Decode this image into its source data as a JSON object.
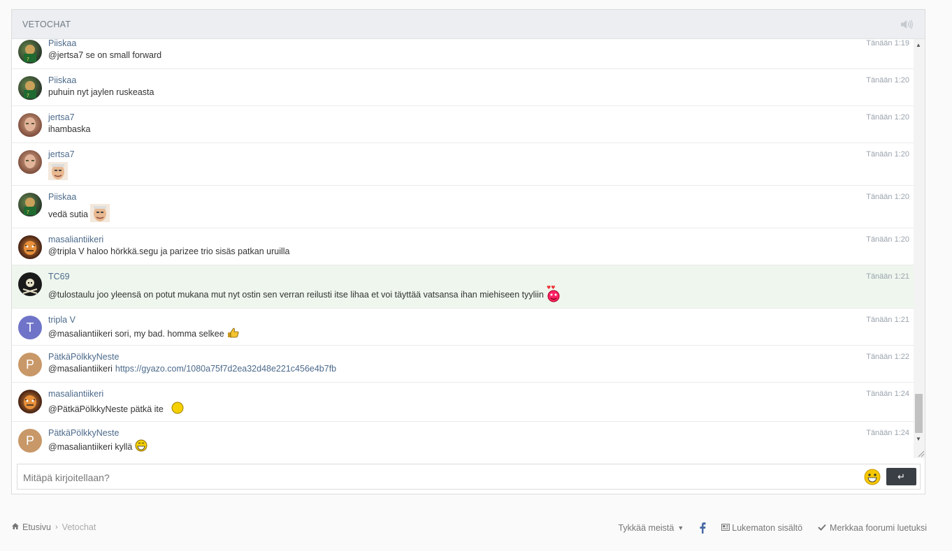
{
  "header": {
    "title": "VETOCHAT",
    "sound_icon": "volume-icon"
  },
  "messages": [
    {
      "user": "Piiskaa",
      "time": "Tänään 1:19",
      "text": "@jertsa7 se on small forward"
    },
    {
      "user": "Piiskaa",
      "time": "Tänään 1:20",
      "text": "puhuin nyt jaylen ruskeasta"
    },
    {
      "user": "jertsa7",
      "time": "Tänään 1:20",
      "text": "ihambaska"
    },
    {
      "user": "jertsa7",
      "time": "Tänään 1:20",
      "text": ""
    },
    {
      "user": "Piiskaa",
      "time": "Tänään 1:20",
      "text": "vedä sutia"
    },
    {
      "user": "masaliantiikeri",
      "time": "Tänään 1:20",
      "text": "@tripla V haloo hörkkä.segu ja parizee trio sisäs patkan uruilla"
    },
    {
      "user": "TC69",
      "time": "Tänään 1:21",
      "text": "@tulostaulu joo yleensä on potut mukana mut nyt ostin sen verran reilusti itse lihaa et voi täyttää vatsansa ihan miehiseen tyyliin"
    },
    {
      "user": "tripla V",
      "time": "Tänään 1:21",
      "text": "@masaliantiikeri sori, my bad. homma selkee",
      "initial": "T"
    },
    {
      "user": "PätkäPölkkyNeste",
      "time": "Tänään 1:22",
      "text": "@masaliantiikeri",
      "link": "https://gyazo.com/1080a75f7d2ea32d48e221c456e4b7fb",
      "initial": "P"
    },
    {
      "user": "masaliantiikeri",
      "time": "Tänään 1:24",
      "text": "@PätkäPölkkyNeste pätkä ite"
    },
    {
      "user": "PätkäPölkkyNeste",
      "time": "Tänään 1:24",
      "text": "@masaliantiikeri kyllä",
      "initial": "P"
    }
  ],
  "input": {
    "placeholder": "Mitäpä kirjoitellaan?",
    "send_label": "↵"
  },
  "footer": {
    "home": "Etusivu",
    "current": "Vetochat",
    "like": "Tykkää meistä",
    "unread": "Lukematon sisältö",
    "mark_read": "Merkkaa foorumi luetuksi"
  },
  "colors": {
    "accent": "#4c6a8a",
    "highlight_bg": "#eef6ee",
    "tripla_avatar": "#6f74c8",
    "patka_avatar": "#c89868"
  }
}
